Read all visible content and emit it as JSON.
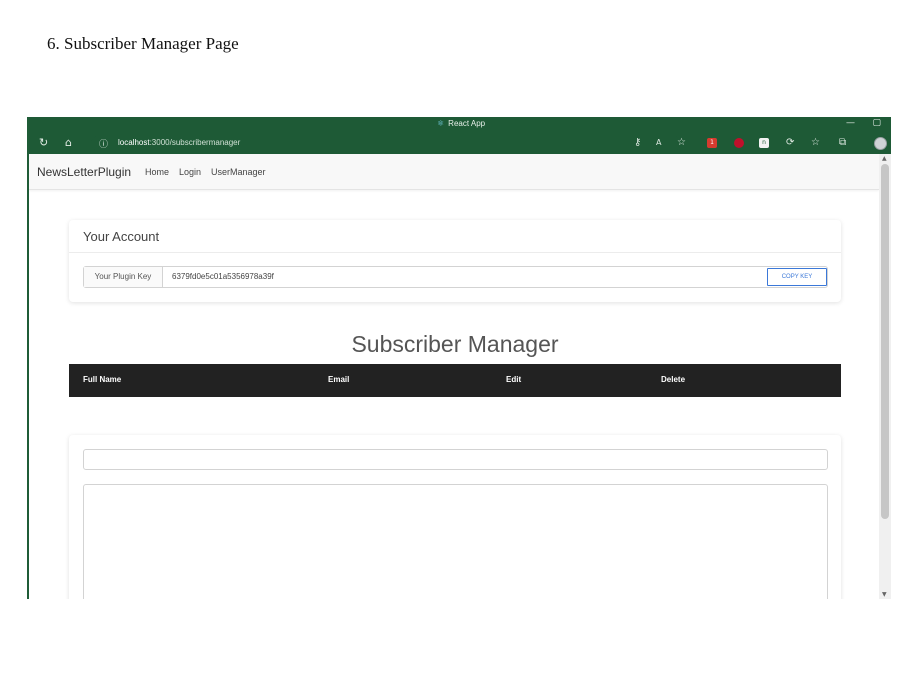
{
  "caption": "6. Subscriber Manager Page",
  "browser": {
    "window_title": "React App",
    "url_host": "localhost",
    "url_path": ":3000/subscribermanager",
    "ext_badge_1": "1",
    "ext_badge_3": "n"
  },
  "navbar": {
    "brand": "NewsLetterPlugin",
    "links": [
      "Home",
      "Login",
      "UserManager"
    ]
  },
  "account": {
    "title": "Your Account",
    "key_label": "Your Plugin Key",
    "key_value": "6379fd0e5c01a5356978a39f",
    "copy_label": "COPY KEY"
  },
  "subscribers": {
    "heading": "Subscriber Manager",
    "columns": [
      "Full Name",
      "Email",
      "Edit",
      "Delete"
    ],
    "rows": []
  },
  "colors": {
    "browser_chrome": "#1e5a36",
    "table_header": "#222222",
    "accent": "#3b78d8"
  }
}
